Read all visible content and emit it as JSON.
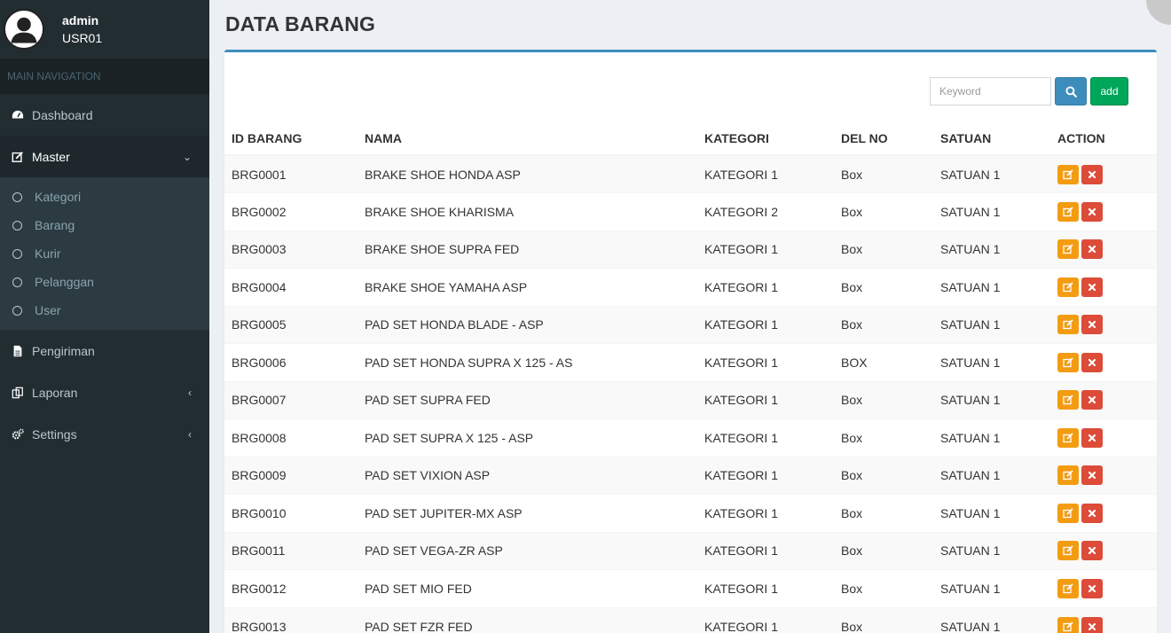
{
  "user": {
    "name": "admin",
    "id": "USR01"
  },
  "nav": {
    "header": "MAIN NAVIGATION",
    "items": [
      {
        "label": "Dashboard",
        "icon": "dashboard-icon"
      },
      {
        "label": "Master",
        "icon": "edit-icon",
        "chevron": "⌄"
      },
      {
        "label": "Pengiriman",
        "icon": "file-icon"
      },
      {
        "label": "Laporan",
        "icon": "copy-icon",
        "chevron": "‹"
      },
      {
        "label": "Settings",
        "icon": "cogs-icon",
        "chevron": "‹"
      }
    ],
    "master_sub": [
      "Kategori",
      "Barang",
      "Kurir",
      "Pelanggan",
      "User"
    ]
  },
  "page": {
    "title": "DATA BARANG"
  },
  "toolbar": {
    "search_placeholder": "Keyword",
    "add_label": "add"
  },
  "table": {
    "headers": [
      "ID BARANG",
      "NAMA",
      "KATEGORI",
      "DEL NO",
      "SATUAN",
      "ACTION"
    ],
    "rows": [
      [
        "BRG0001",
        "BRAKE SHOE HONDA ASP",
        "KATEGORI 1",
        "Box",
        "SATUAN 1"
      ],
      [
        "BRG0002",
        "BRAKE SHOE KHARISMA",
        "KATEGORI 2",
        "Box",
        "SATUAN 1"
      ],
      [
        "BRG0003",
        "BRAKE SHOE SUPRA FED",
        "KATEGORI 1",
        "Box",
        "SATUAN 1"
      ],
      [
        "BRG0004",
        "BRAKE SHOE YAMAHA ASP",
        "KATEGORI 1",
        "Box",
        "SATUAN 1"
      ],
      [
        "BRG0005",
        "PAD SET HONDA BLADE - ASP",
        "KATEGORI 1",
        "Box",
        "SATUAN 1"
      ],
      [
        "BRG0006",
        "PAD SET HONDA SUPRA X 125 - AS",
        "KATEGORI 1",
        "BOX",
        "SATUAN 1"
      ],
      [
        "BRG0007",
        "PAD SET SUPRA FED",
        "KATEGORI 1",
        "Box",
        "SATUAN 1"
      ],
      [
        "BRG0008",
        "PAD SET SUPRA X 125 - ASP",
        "KATEGORI 1",
        "Box",
        "SATUAN 1"
      ],
      [
        "BRG0009",
        "PAD SET VIXION ASP",
        "KATEGORI 1",
        "Box",
        "SATUAN 1"
      ],
      [
        "BRG0010",
        "PAD SET JUPITER-MX ASP",
        "KATEGORI 1",
        "Box",
        "SATUAN 1"
      ],
      [
        "BRG0011",
        "PAD SET VEGA-ZR ASP",
        "KATEGORI 1",
        "Box",
        "SATUAN 1"
      ],
      [
        "BRG0012",
        "PAD SET MIO FED",
        "KATEGORI 1",
        "Box",
        "SATUAN 1"
      ],
      [
        "BRG0013",
        "PAD SET FZR FED",
        "KATEGORI 1",
        "Box",
        "SATUAN 1"
      ]
    ]
  },
  "colors": {
    "sidebar": "#222d32",
    "primary": "#3c8dbc",
    "success": "#00a65a",
    "warning": "#f39c12",
    "danger": "#dd4b39"
  }
}
